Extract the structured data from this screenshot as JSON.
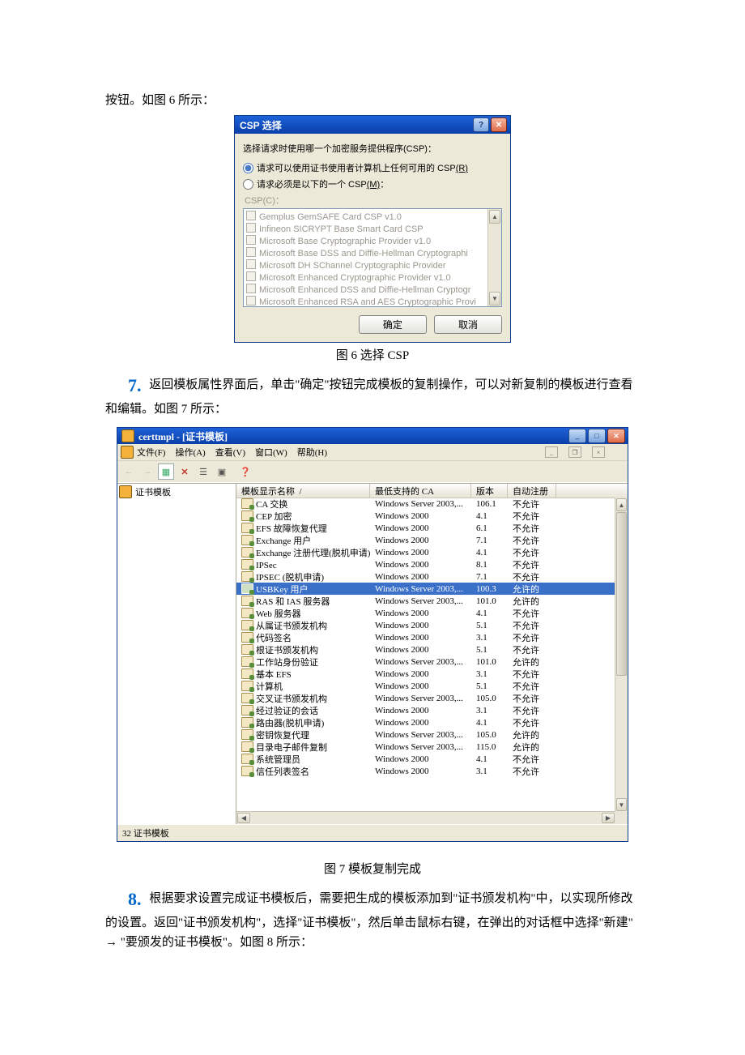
{
  "intro": {
    "line1": "按钮。如图 6 所示："
  },
  "dlg1": {
    "title": "CSP 选择",
    "prompt": "选择请求时使用哪一个加密服务提供程序(CSP)：",
    "radio1_pre": "请求可以使用证书使用者计算机上任何可用的 CSP",
    "radio1_hot": "(R)",
    "radio2_pre": "请求必须是以下的一个 CSP",
    "radio2_hot": "(M)",
    "radio2_post": "：",
    "list_label": "CSP(C)：",
    "items": [
      "Gemplus GemSAFE Card CSP v1.0",
      "Infineon SICRYPT Base Smart Card CSP",
      "Microsoft Base Cryptographic Provider v1.0",
      "Microsoft Base DSS and Diffie-Hellman Cryptographi",
      "Microsoft DH SChannel Cryptographic Provider",
      "Microsoft Enhanced Cryptographic Provider v1.0",
      "Microsoft Enhanced DSS and Diffie-Hellman Cryptogr",
      "Microsoft Enhanced RSA and AES Cryptographic Provi"
    ],
    "ok": "确定",
    "cancel": "取消"
  },
  "cap6": "图 6 选择 CSP",
  "step7": {
    "num": "7.",
    "text": "返回模板属性界面后，单击\"确定\"按钮完成模板的复制操作，可以对新复制的模板进行查看和编辑。如图 7 所示："
  },
  "mmc": {
    "title": "certtmpl - [证书模板]",
    "menu": {
      "file": "文件(F)",
      "action": "操作(A)",
      "view": "查看(V)",
      "window": "窗口(W)",
      "help": "帮助(H)"
    },
    "tree_root": "证书模板",
    "cols": {
      "name": "模板显示名称",
      "ca": "最低支持的 CA",
      "ver": "版本",
      "auto": "自动注册"
    },
    "rows": [
      {
        "n": "CA 交换",
        "c": "Windows Server 2003,...",
        "v": "106.1",
        "a": "不允许",
        "sel": false
      },
      {
        "n": "CEP 加密",
        "c": "Windows 2000",
        "v": "4.1",
        "a": "不允许",
        "sel": false
      },
      {
        "n": "EFS 故障恢复代理",
        "c": "Windows 2000",
        "v": "6.1",
        "a": "不允许",
        "sel": false
      },
      {
        "n": "Exchange 用户",
        "c": "Windows 2000",
        "v": "7.1",
        "a": "不允许",
        "sel": false
      },
      {
        "n": "Exchange 注册代理(脱机申请)",
        "c": "Windows 2000",
        "v": "4.1",
        "a": "不允许",
        "sel": false
      },
      {
        "n": "IPSec",
        "c": "Windows 2000",
        "v": "8.1",
        "a": "不允许",
        "sel": false
      },
      {
        "n": "IPSEC (脱机申请)",
        "c": "Windows 2000",
        "v": "7.1",
        "a": "不允许",
        "sel": false
      },
      {
        "n": "USBKey 用户",
        "c": "Windows Server 2003,...",
        "v": "100.3",
        "a": "允许的",
        "sel": true
      },
      {
        "n": "RAS 和 IAS 服务器",
        "c": "Windows Server 2003,...",
        "v": "101.0",
        "a": "允许的",
        "sel": false
      },
      {
        "n": "Web 服务器",
        "c": "Windows 2000",
        "v": "4.1",
        "a": "不允许",
        "sel": false
      },
      {
        "n": "从属证书颁发机构",
        "c": "Windows 2000",
        "v": "5.1",
        "a": "不允许",
        "sel": false
      },
      {
        "n": "代码签名",
        "c": "Windows 2000",
        "v": "3.1",
        "a": "不允许",
        "sel": false
      },
      {
        "n": "根证书颁发机构",
        "c": "Windows 2000",
        "v": "5.1",
        "a": "不允许",
        "sel": false
      },
      {
        "n": "工作站身份验证",
        "c": "Windows Server 2003,...",
        "v": "101.0",
        "a": "允许的",
        "sel": false
      },
      {
        "n": "基本 EFS",
        "c": "Windows 2000",
        "v": "3.1",
        "a": "不允许",
        "sel": false
      },
      {
        "n": "计算机",
        "c": "Windows 2000",
        "v": "5.1",
        "a": "不允许",
        "sel": false
      },
      {
        "n": "交叉证书颁发机构",
        "c": "Windows Server 2003,...",
        "v": "105.0",
        "a": "不允许",
        "sel": false
      },
      {
        "n": "经过验证的会话",
        "c": "Windows 2000",
        "v": "3.1",
        "a": "不允许",
        "sel": false
      },
      {
        "n": "路由器(脱机申请)",
        "c": "Windows 2000",
        "v": "4.1",
        "a": "不允许",
        "sel": false
      },
      {
        "n": "密钥恢复代理",
        "c": "Windows Server 2003,...",
        "v": "105.0",
        "a": "允许的",
        "sel": false
      },
      {
        "n": "目录电子邮件复制",
        "c": "Windows Server 2003,...",
        "v": "115.0",
        "a": "允许的",
        "sel": false
      },
      {
        "n": "系统管理员",
        "c": "Windows 2000",
        "v": "4.1",
        "a": "不允许",
        "sel": false
      },
      {
        "n": "信任列表签名",
        "c": "Windows 2000",
        "v": "3.1",
        "a": "不允许",
        "sel": false
      }
    ],
    "status": "32 证书模板"
  },
  "cap7": "图 7 模板复制完成",
  "step8": {
    "num": "8.",
    "text_a": "根据要求设置完成证书模板后，需要把生成的模板添加到\"证书颁发机构\"中，以实现所修改的设置。返回\"证书颁发机构\"，选择\"证书模板\"，然后单击鼠标右键，在弹出的对话框中选择\"新建\"",
    "arrow": "→",
    "text_b": "\"要颁发的证书模板\"。如图 8 所示："
  }
}
